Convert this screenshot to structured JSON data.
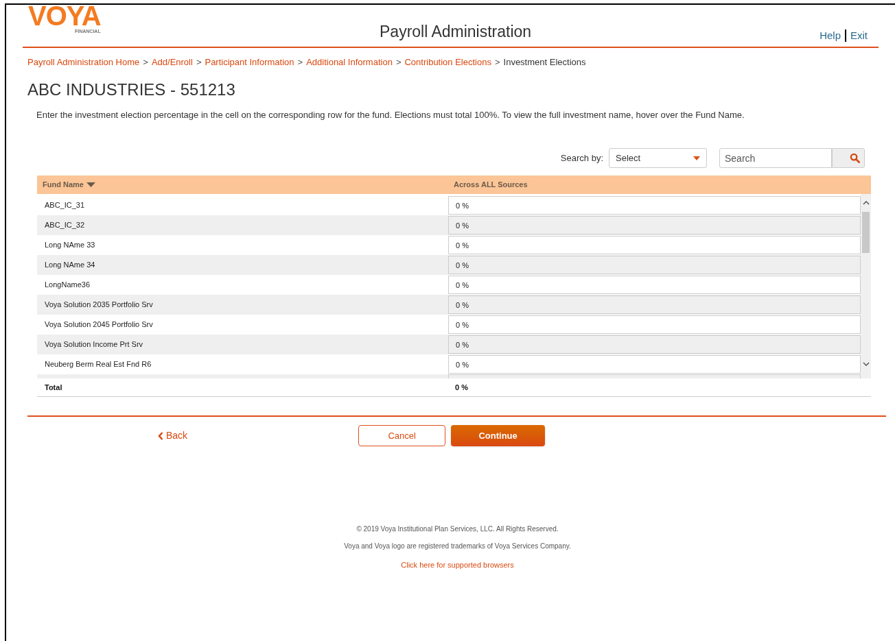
{
  "logo": {
    "wordmark": "VOYA",
    "tagline": "FINANCIAL"
  },
  "header": {
    "title": "Payroll Administration",
    "links": [
      "Help",
      "Exit"
    ]
  },
  "breadcrumbs": [
    {
      "label": "Payroll Administration Home",
      "current": false
    },
    {
      "label": "Add/Enroll",
      "current": false
    },
    {
      "label": "Participant Information",
      "current": false
    },
    {
      "label": "Additional Information",
      "current": false
    },
    {
      "label": "Contribution Elections",
      "current": false
    },
    {
      "label": "Investment Elections",
      "current": true
    }
  ],
  "breadcrumb_separator": ">",
  "heading": "ABC INDUSTRIES - 551213",
  "instructions": "Enter the investment election percentage in the cell on the corresponding row for the fund. Elections must total 100%. To view the full investment name, hover over the Fund Name.",
  "search": {
    "label": "Search by:",
    "select_value": "Select",
    "placeholder": "Search"
  },
  "table": {
    "columns": [
      "Fund Name",
      "Across ALL Sources"
    ],
    "rows": [
      {
        "fund": "ABC_IC_31",
        "value": "0 %"
      },
      {
        "fund": "ABC_IC_32",
        "value": "0 %"
      },
      {
        "fund": "Long NAme 33",
        "value": "0 %"
      },
      {
        "fund": "Long NAme 34",
        "value": "0 %"
      },
      {
        "fund": "LongName36",
        "value": "0 %"
      },
      {
        "fund": "Voya Solution 2035 Portfolio Srv",
        "value": "0 %"
      },
      {
        "fund": "Voya Solution 2045 Portfolio Srv",
        "value": "0 %"
      },
      {
        "fund": "Voya Solution Income Prt Srv",
        "value": "0 %"
      },
      {
        "fund": "Neuberg Berm Real Est Fnd R6",
        "value": "0 %"
      }
    ],
    "total": {
      "label": "Total",
      "value": "0 %"
    }
  },
  "actions": {
    "back": "Back",
    "cancel": "Cancel",
    "continue": "Continue"
  },
  "footer": {
    "copyright": "© 2019 Voya Institutional Plan Services, LLC. All Rights Reserved.",
    "trademark": "Voya and Voya logo are registered trademarks of Voya Services Company.",
    "link": "Click here for supported browsers"
  }
}
